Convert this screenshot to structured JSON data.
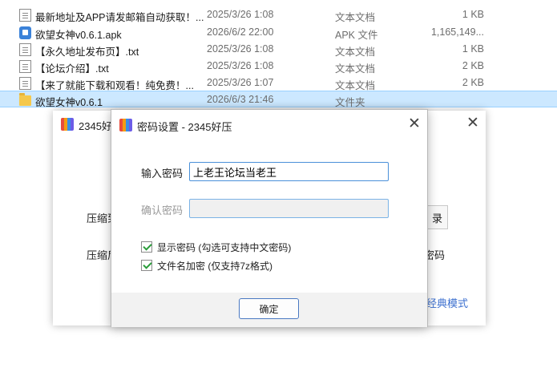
{
  "files": [
    {
      "name": "最新地址及APP请发邮箱自动获取！...",
      "date": "2025/3/26 1:08",
      "type": "文本文档",
      "size": "1 KB",
      "icon": "txt-file-icon"
    },
    {
      "name": "欲望女神v0.6.1.apk",
      "date": "2026/6/2 22:00",
      "type": "APK 文件",
      "size": "1,165,149...",
      "icon": "apk-file-icon"
    },
    {
      "name": "【永久地址发布页】.txt",
      "date": "2025/3/26 1:08",
      "type": "文本文档",
      "size": "1 KB",
      "icon": "txt-file-icon"
    },
    {
      "name": "【论坛介绍】.txt",
      "date": "2025/3/26 1:08",
      "type": "文本文档",
      "size": "2 KB",
      "icon": "txt-file-icon"
    },
    {
      "name": "【来了就能下载和观看！纯免费！...",
      "date": "2025/3/26 1:07",
      "type": "文本文档",
      "size": "2 KB",
      "icon": "txt-file-icon"
    },
    {
      "name": "欲望女神v0.6.1",
      "date": "2026/6/3 21:46",
      "type": "文件夹",
      "size": "",
      "icon": "folder-icon",
      "selected": true
    }
  ],
  "background_window": {
    "title": "2345好",
    "label_1": "压缩到",
    "label_2": "压缩后",
    "button_fragment": "录",
    "right_text": "密码",
    "link_text": "经典模式"
  },
  "dialog": {
    "title": "密码设置 - 2345好压",
    "password_label": "输入密码",
    "password_value": "上老王论坛当老王",
    "confirm_label": "确认密码",
    "confirm_value": "",
    "show_password_label": "显示密码 (勾选可支持中文密码)",
    "encrypt_names_label": "文件名加密 (仅支持7z格式)",
    "ok_label": "确定"
  },
  "colors": {
    "selection_bg": "#cce8ff",
    "link": "#3b6fcf",
    "input_focus_border": "#4a90d9",
    "check_mark": "#2a9d3a"
  }
}
